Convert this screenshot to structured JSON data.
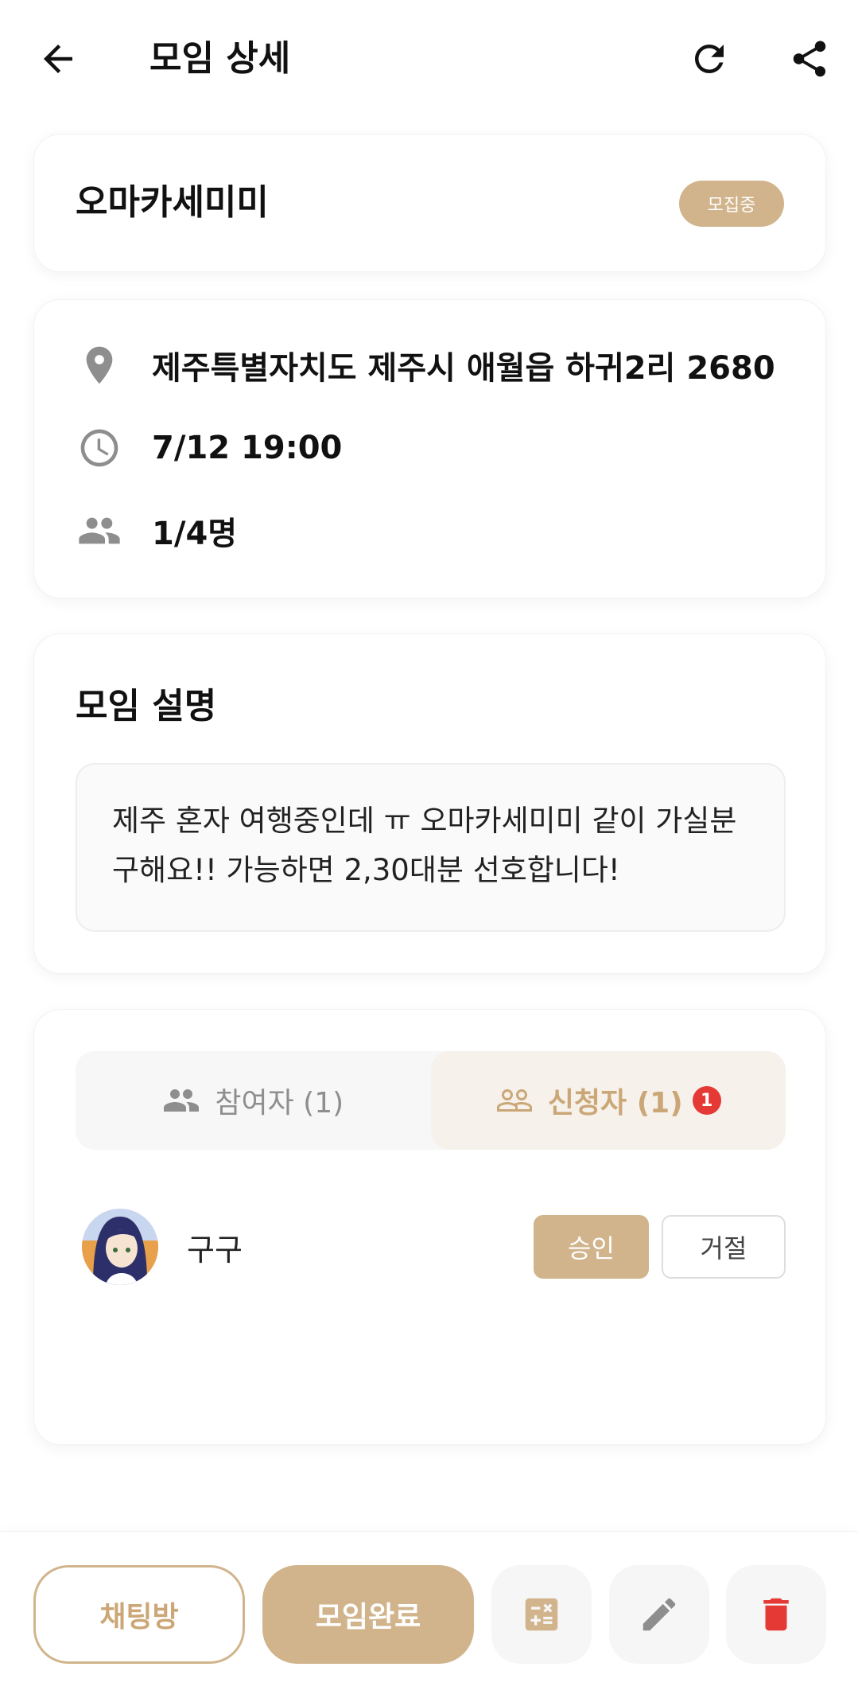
{
  "header": {
    "title": "모임 상세",
    "back_icon": "arrow-left-icon",
    "refresh_icon": "refresh-icon",
    "share_icon": "share-icon"
  },
  "meeting": {
    "name": "오마카세미미",
    "status": "모집중",
    "address": "제주특별자치도 제주시 애월읍 하귀2리 2680",
    "datetime": "7/12 19:00",
    "capacity": "1/4명"
  },
  "description": {
    "heading": "모임 설명",
    "text": "제주 혼자 여행중인데 ㅠ 오마카세미미 같이 가실분 구해요!! 가능하면 2,30대분 선호합니다!"
  },
  "tabs": {
    "participants_label": "참여자 (1)",
    "applicants_label": "신청자 (1)",
    "applicants_badge": "1",
    "selected": "applicants"
  },
  "applicants": [
    {
      "name": "구구",
      "approve_label": "승인",
      "reject_label": "거절"
    }
  ],
  "bottom": {
    "chat_label": "채팅방",
    "complete_label": "모임완료",
    "calculator_icon": "calculator-icon",
    "edit_icon": "pencil-icon",
    "delete_icon": "trash-icon"
  },
  "colors": {
    "accent": "#d1b48c",
    "accent_text": "#cba777",
    "danger": "#e53935",
    "icon_gray": "#8e8e8e"
  }
}
